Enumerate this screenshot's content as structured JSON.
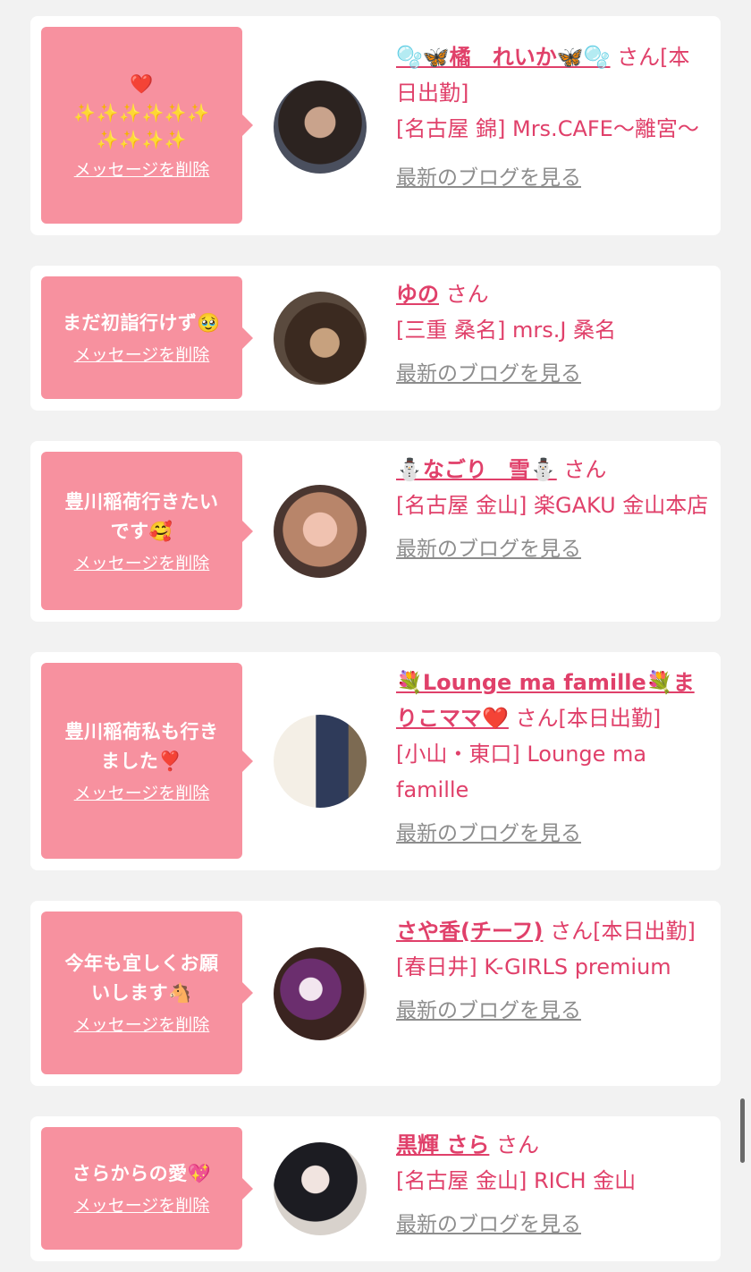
{
  "actions": {
    "delete_label": "メッセージを削除",
    "blog_label": "最新のブログを見る",
    "honorific": "さん"
  },
  "cards": [
    {
      "message_line1": "❤️",
      "message_line2": "✨✨✨✨✨✨",
      "message_line3": "✨✨✨✨",
      "name": "🫧🦋橘　れいか🦋🫧",
      "status": "[本日出勤]",
      "shop": "[名古屋 錦] Mrs.CAFE〜離宮〜"
    },
    {
      "message_line1": "まだ初詣行けず🥹",
      "name": "ゆの",
      "status": "",
      "shop": "[三重 桑名] mrs.J 桑名"
    },
    {
      "message_line1": "豊川稲荷行きたい",
      "message_line2": "です🥰",
      "name": "⛄なごり　雪⛄",
      "status": "",
      "shop": "[名古屋 金山] 楽GAKU 金山本店"
    },
    {
      "message_line1": "豊川稲荷私も行き",
      "message_line2": "ました❣️",
      "name": "💐Lounge ma famille💐まりこママ❤️",
      "status": "[本日出勤]",
      "shop": "[小山・東口] Lounge ma famille"
    },
    {
      "message_line1": "今年も宜しくお願",
      "message_line2": "いします🐴",
      "name": "さや香(チーフ)",
      "status": "[本日出勤]",
      "shop": "[春日井] K-GIRLS premium"
    },
    {
      "message_line1": "さらからの愛💖",
      "name": "黒輝 さら",
      "status": "",
      "shop": "[名古屋 金山] RICH 金山"
    }
  ],
  "colors": {
    "accent": "#e0406a",
    "bubble": "#f7919f",
    "link_gray": "#8d8d8d",
    "background": "#f2f2f2"
  }
}
